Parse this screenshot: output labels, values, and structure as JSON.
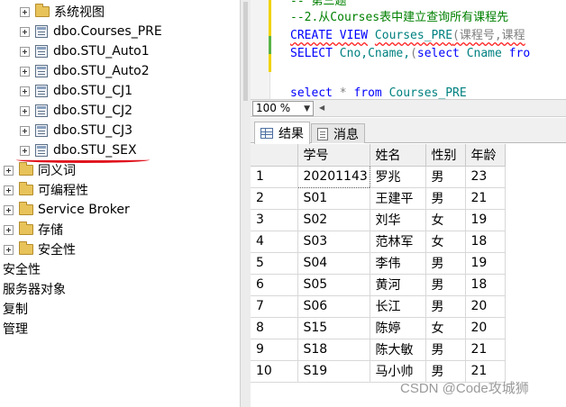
{
  "explorer": {
    "view_items": [
      "系统视图",
      "dbo.Courses_PRE",
      "dbo.STU_Auto1",
      "dbo.STU_Auto2",
      "dbo.STU_CJ1",
      "dbo.STU_CJ2",
      "dbo.STU_CJ3",
      "dbo.STU_SEX"
    ],
    "folders": [
      "同义词",
      "可编程性",
      "Service Broker",
      "存储",
      "安全性"
    ],
    "top_items": [
      "安全性",
      "服务器对象",
      "复制",
      "管理"
    ]
  },
  "editor": {
    "line_partial": "-- 第三题",
    "line_comment": "--2.从Courses表中建立查询所有课程先",
    "line_create_kw": "CREATE VIEW",
    "line_create_obj": "Courses_PRE",
    "line_create_rest": "(课程号,课程",
    "line_select_kw": "SELECT",
    "line_select_cols": "Cno,Cname,",
    "line_select_paren": "(",
    "line_select_kw2": "select",
    "line_select_obj": "Cname",
    "line_select_kw3": "fro",
    "line_q_kw": "select",
    "line_q_star": "*",
    "line_q_kw2": "from",
    "line_q_obj": "Courses_PRE"
  },
  "zoom": {
    "value": "100 %"
  },
  "tabs": {
    "results": "结果",
    "messages": "消息"
  },
  "grid": {
    "columns": [
      "学号",
      "姓名",
      "性别",
      "年龄"
    ],
    "rows": [
      [
        "1",
        "20201143",
        "罗兆",
        "男",
        "23"
      ],
      [
        "2",
        "S01",
        "王建平",
        "男",
        "21"
      ],
      [
        "3",
        "S02",
        "刘华",
        "女",
        "19"
      ],
      [
        "4",
        "S03",
        "范林军",
        "女",
        "18"
      ],
      [
        "5",
        "S04",
        "李伟",
        "男",
        "19"
      ],
      [
        "6",
        "S05",
        "黄河",
        "男",
        "18"
      ],
      [
        "7",
        "S06",
        "长江",
        "男",
        "20"
      ],
      [
        "8",
        "S15",
        "陈婷",
        "女",
        "20"
      ],
      [
        "9",
        "S18",
        "陈大敏",
        "男",
        "21"
      ],
      [
        "10",
        "S19",
        "马小帅",
        "男",
        "21"
      ]
    ]
  },
  "watermark": "CSDN @Code攻城狮",
  "colors": {
    "keyword": "#0000ff",
    "comment": "#008000",
    "object": "#008080",
    "highlight_line": "#e0141e"
  }
}
